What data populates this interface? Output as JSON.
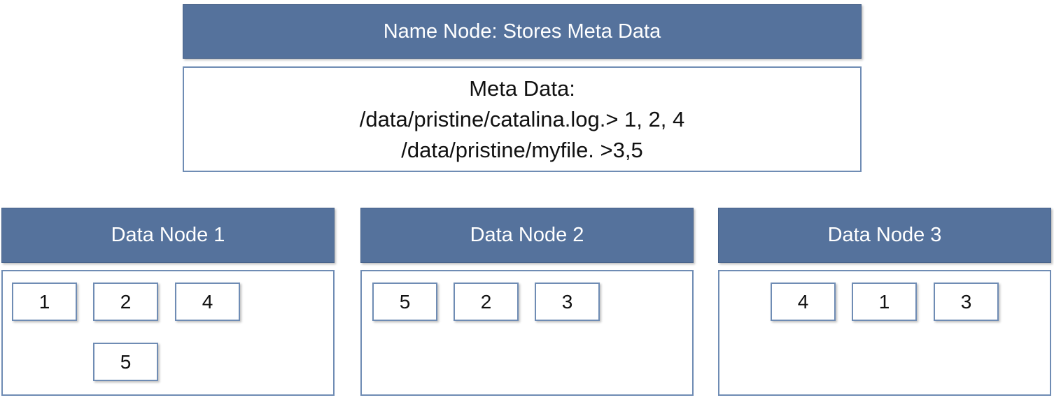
{
  "name_node": {
    "title": "Name Node: Stores Meta Data"
  },
  "meta_data": {
    "heading": "Meta Data:",
    "lines": [
      "/data/pristine/catalina.log.> 1, 2, 4",
      "/data/pristine/myfile. >3,5"
    ]
  },
  "data_nodes": [
    {
      "title": "Data Node 1",
      "blocks": [
        "1",
        "2",
        "4",
        "5"
      ]
    },
    {
      "title": "Data Node 2",
      "blocks": [
        "5",
        "2",
        "3"
      ]
    },
    {
      "title": "Data Node 3",
      "blocks": [
        "4",
        "1",
        "3"
      ]
    }
  ],
  "colors": {
    "header_fill": "#55729c",
    "box_border": "#6f8cb4",
    "header_text": "#ffffff"
  }
}
